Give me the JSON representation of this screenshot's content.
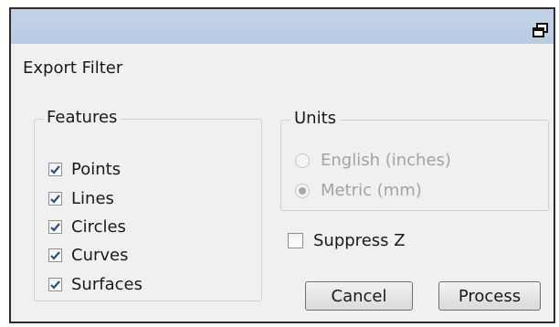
{
  "window": {
    "restore_icon": "restore-window-icon"
  },
  "form": {
    "title": "Export Filter"
  },
  "features": {
    "legend": "Features",
    "items": [
      {
        "label": "Points",
        "checked": true
      },
      {
        "label": "Lines",
        "checked": true
      },
      {
        "label": "Circles",
        "checked": true
      },
      {
        "label": "Curves",
        "checked": true
      },
      {
        "label": "Surfaces",
        "checked": true
      }
    ]
  },
  "units": {
    "legend": "Units",
    "options": [
      {
        "label": "English (inches)",
        "selected": false,
        "enabled": false
      },
      {
        "label": "Metric (mm)",
        "selected": true,
        "enabled": false
      }
    ]
  },
  "suppress_z": {
    "label": "Suppress Z",
    "checked": false
  },
  "buttons": {
    "cancel": "Cancel",
    "process": "Process"
  },
  "colors": {
    "titlebar": "#bfcfe6",
    "dialog_bg": "#f0f0f0",
    "check_mark": "#2b4c8c",
    "disabled_text": "#a3a3a3"
  }
}
